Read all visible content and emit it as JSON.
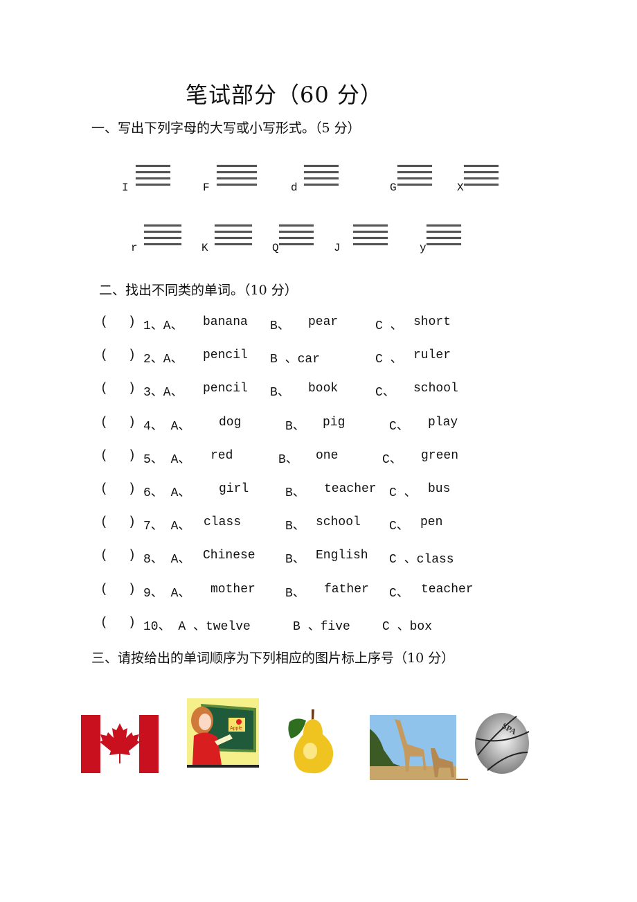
{
  "title": "笔试部分（60 分）",
  "section1": {
    "heading": "一、写出下列字母的大写或小写形式。（5 分）",
    "row1": [
      "I",
      "F",
      "d",
      "G",
      "X"
    ],
    "row2": [
      "r",
      "K",
      "Q",
      "J",
      "y"
    ]
  },
  "section2": {
    "heading": "二、找出不同类的单词。（10 分）",
    "questions": [
      {
        "paren": "(",
        "close": ")",
        "num": "1、A、",
        "a": "banana",
        "b_label": "B、",
        "b": "pear",
        "c_label": "C 、",
        "c": "short"
      },
      {
        "paren": "(",
        "close": ")",
        "num": "2、A、",
        "a": "pencil",
        "b_label": "B 、car",
        "b": "",
        "c_label": "C 、",
        "c": "ruler"
      },
      {
        "paren": "(",
        "close": ")",
        "num": "3、A、",
        "a": "pencil",
        "b_label": "B、",
        "b": "book",
        "c_label": "C、",
        "c": "school"
      },
      {
        "paren": "(",
        "close": ")",
        "num": "4、  A、",
        "a": "dog",
        "b_label": "B、",
        "b": "pig",
        "c_label": "C、",
        "c": "play"
      },
      {
        "paren": "(",
        "close": ")",
        "num": "5、  A、",
        "a": "red",
        "b_label": "B、",
        "b": "one",
        "c_label": "C、",
        "c": "green"
      },
      {
        "paren": "(",
        "close": ")",
        "num": "6、  A、",
        "a": "girl",
        "b_label": "B、",
        "b": "teacher",
        "c_label": "C 、",
        "c": "bus"
      },
      {
        "paren": "(",
        "close": ")",
        "num": "7、 A、",
        "a": "class",
        "b_label": "B、",
        "b": "school",
        "c_label": "C、",
        "c": "pen"
      },
      {
        "paren": "(",
        "close": ")",
        "num": "8、 A、",
        "a": "Chinese",
        "b_label": "B、",
        "b": "English",
        "c_label": "C 、class",
        "c": ""
      },
      {
        "paren": "(",
        "close": ")",
        "num": "9、  A、",
        "a": "mother",
        "b_label": "B、",
        "b": "father",
        "c_label": "C、",
        "c": "teacher"
      },
      {
        "paren": "(",
        "close": ")",
        "num": "10、 A 、twelve",
        "a": "",
        "b_label": "B 、five",
        "b": "",
        "c_label": "C 、box",
        "c": ""
      }
    ]
  },
  "section3": {
    "heading": "三、请按给出的单词顺序为下列相应的图片标上序号（10 分）",
    "pictures": [
      "canada-flag",
      "teacher",
      "pear",
      "giraffe",
      "basketball"
    ],
    "teacher_board_text": "Apple",
    "basketball_text": "SPA"
  }
}
